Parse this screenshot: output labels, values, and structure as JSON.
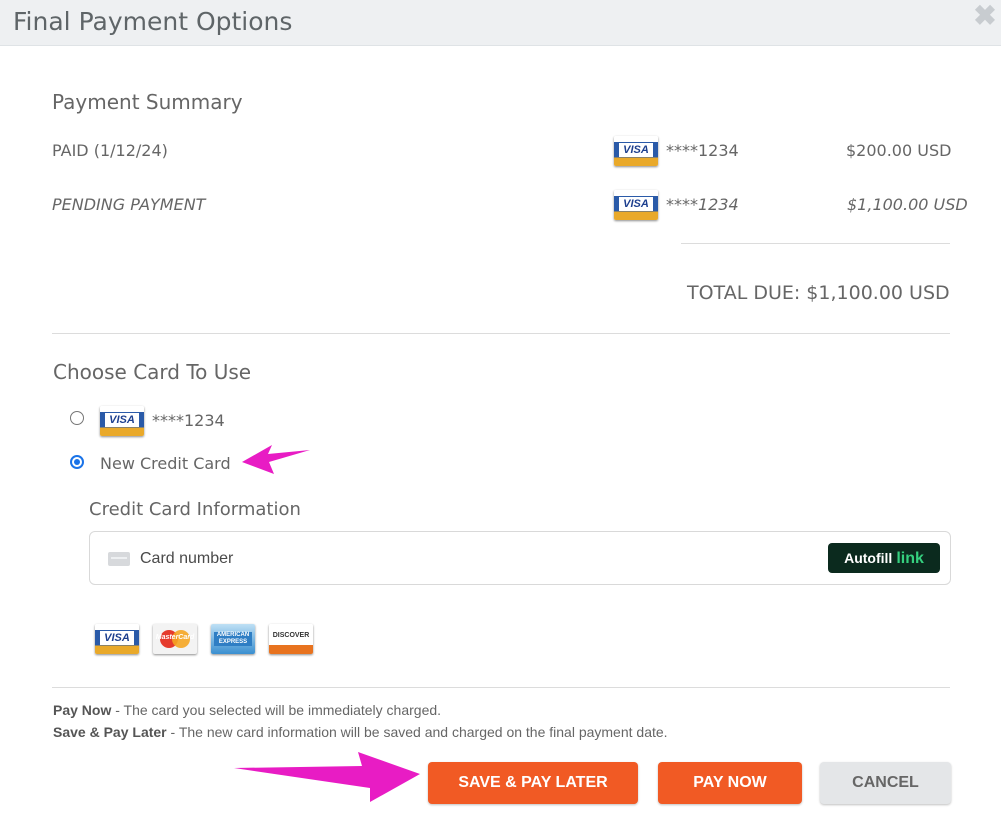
{
  "dialog": {
    "title": "Final Payment Options"
  },
  "summary": {
    "heading": "Payment Summary",
    "rows": [
      {
        "label": "PAID (1/12/24)",
        "card_brand": "VISA",
        "card_masked": "****1234",
        "amount": "$200.00 USD"
      },
      {
        "label": "PENDING PAYMENT",
        "card_brand": "VISA",
        "card_masked": "****1234",
        "amount": "$1,100.00 USD"
      }
    ],
    "total": "TOTAL DUE: $1,100.00 USD"
  },
  "choose": {
    "heading": "Choose Card To Use",
    "options": [
      {
        "card_brand": "VISA",
        "label": "****1234",
        "selected": false
      },
      {
        "label": "New Credit Card",
        "selected": true
      }
    ]
  },
  "card_info": {
    "heading": "Credit Card Information",
    "card_number_placeholder": "Card number",
    "autofill_label": "Autofill",
    "autofill_link": "link",
    "accepted_brands": [
      "VISA",
      "MasterCard",
      "AMERICAN EXPRESS",
      "DISCOVER"
    ]
  },
  "notes": [
    {
      "term": "Pay Now",
      "text": " - The card you selected will be immediately charged."
    },
    {
      "term": "Save & Pay Later",
      "text": " - The new card information will be saved and charged on the final payment date."
    }
  ],
  "buttons": {
    "save_pay_later": "SAVE & PAY LATER",
    "pay_now": "PAY NOW",
    "cancel": "CANCEL"
  },
  "colors": {
    "accent_orange": "#f15a24",
    "annotation_magenta": "#e81cc4",
    "radio_blue": "#1a73e8"
  }
}
